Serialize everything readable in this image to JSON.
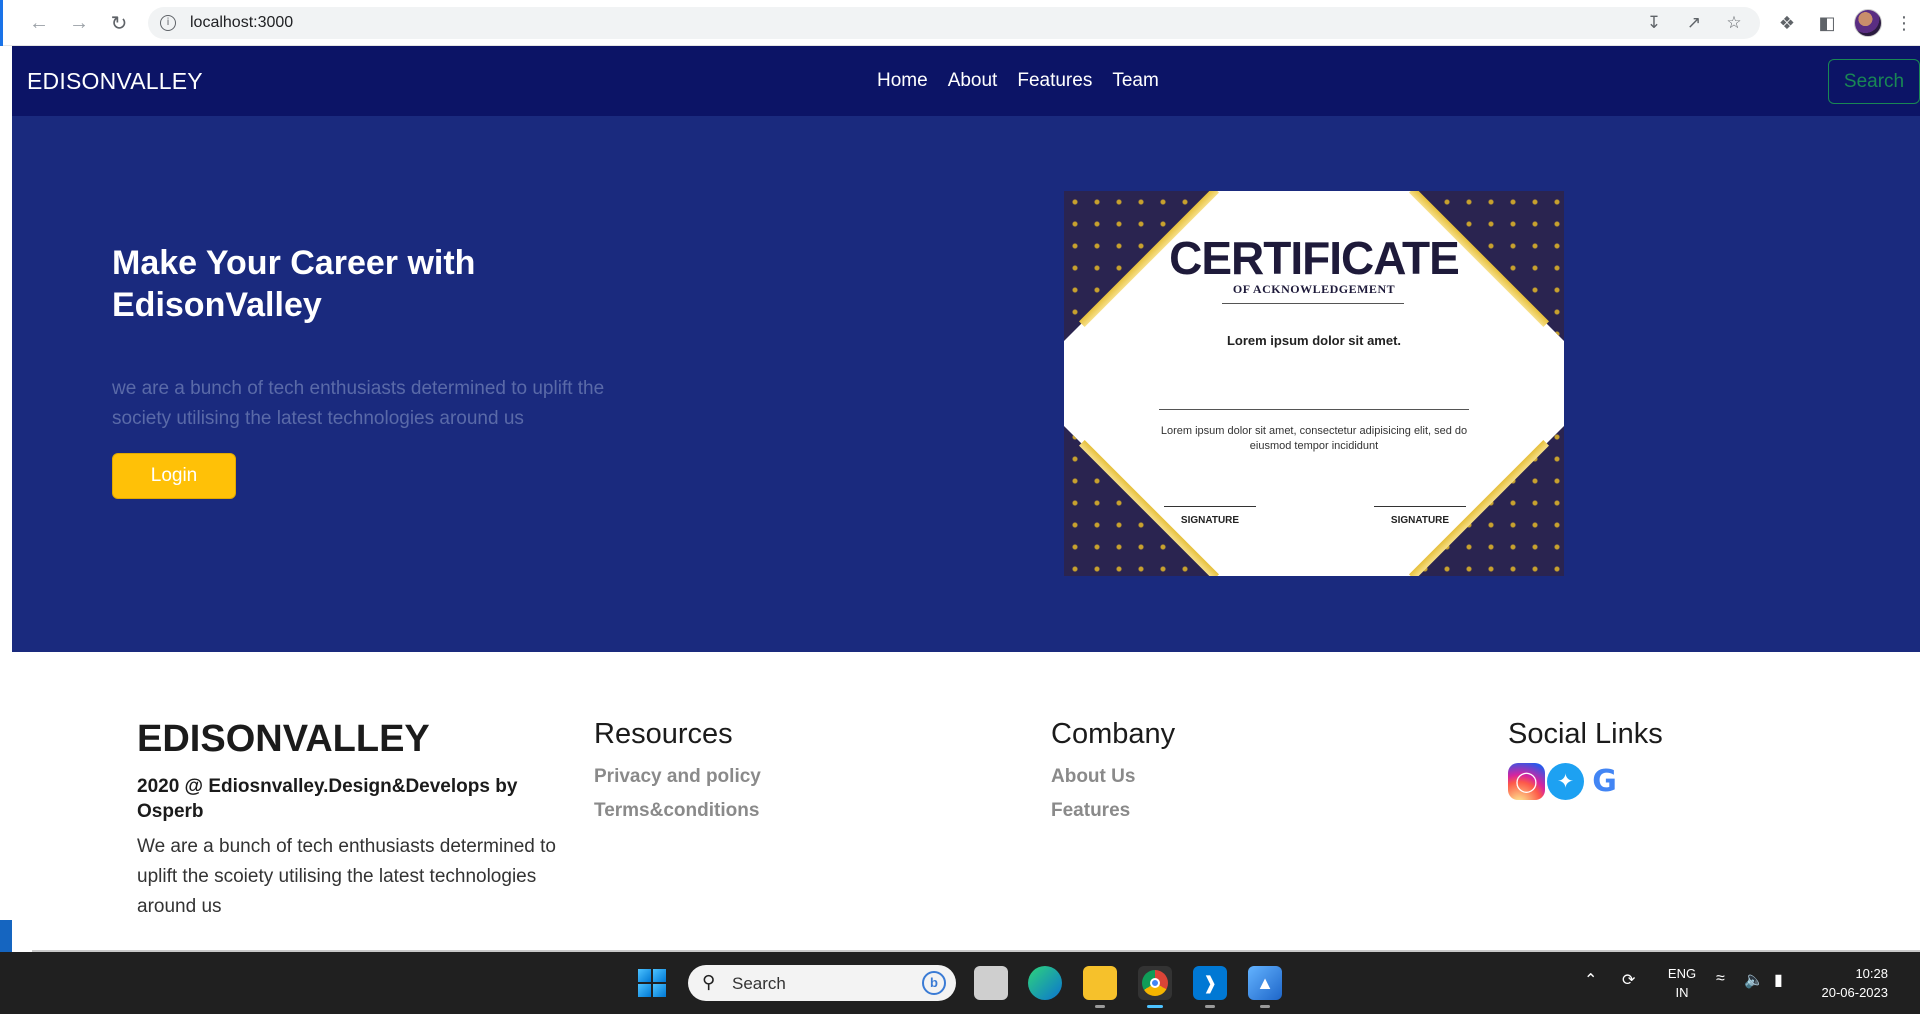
{
  "browser": {
    "url": "localhost:3000"
  },
  "navbar": {
    "brand": "EDISONVALLEY",
    "links": [
      "Home",
      "About",
      "Features",
      "Team"
    ],
    "search_label": "Search"
  },
  "hero": {
    "title": "Make Your Career with EdisonValley",
    "description": "we are a bunch of tech enthusiasts determined to uplift the society utilising the latest technologies around us",
    "login_label": "Login"
  },
  "certificate": {
    "title": "CERTIFICATE",
    "subtitle": "OF ACKNOWLEDGEMENT",
    "line1": "Lorem ipsum dolor sit amet.",
    "line2": "Lorem ipsum dolor sit amet, consectetur adipisicing elit, sed do eiusmod tempor incididunt",
    "signature_left": "SIGNATURE",
    "signature_right": "SIGNATURE"
  },
  "footer": {
    "brand": "EDISONVALLEY",
    "credit": "2020 @ Ediosnvalley.Design&Develops by Osperb",
    "description": "We are a bunch of tech enthusiasts determined to uplift the scoiety utilising the latest technologies around us",
    "resources": {
      "heading": "Resources",
      "links": [
        "Privacy and policy",
        "Terms&conditions"
      ]
    },
    "company": {
      "heading": "Combany",
      "links": [
        "About Us",
        "Features"
      ]
    },
    "social": {
      "heading": "Social Links",
      "icons": [
        "instagram-icon",
        "twitter-icon",
        "google-icon"
      ]
    }
  },
  "taskbar": {
    "search_placeholder": "Search",
    "language": "ENG",
    "region": "IN",
    "time": "10:28",
    "date": "20-06-2023"
  },
  "colors": {
    "navbar_bg": "#0c1466",
    "hero_bg": "#1a2a7e",
    "login_button": "#ffc107",
    "search_button": "#198754"
  }
}
